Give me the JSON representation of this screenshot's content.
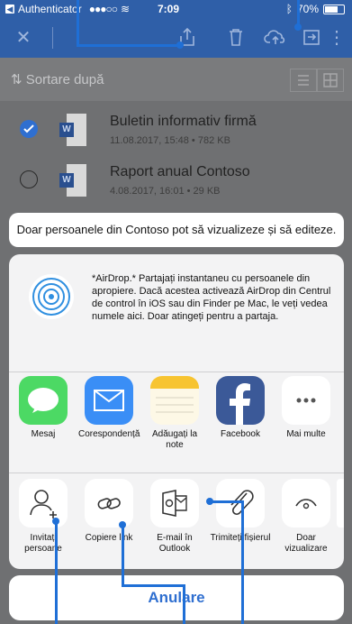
{
  "status_bar": {
    "app_name": "Authenticator",
    "signal": "●●●○○",
    "time": "7:09",
    "battery_pct": "70%"
  },
  "toolbar": {
    "icons": [
      "close-icon",
      "share-icon",
      "trash-icon",
      "cloud-upload-icon",
      "open-in-icon",
      "more-icon"
    ]
  },
  "sort": {
    "label": "⇅ Sortare după"
  },
  "files": [
    {
      "name": "Buletin informativ firmă",
      "meta": "11.08.2017, 15:48 • 782 KB",
      "selected": true
    },
    {
      "name": "Raport anual Contoso",
      "meta": "4.08.2017, 16:01 • 29 KB",
      "selected": false
    }
  ],
  "sheet": {
    "banner": "Doar persoanele din Contoso pot să vizualizeze și să editeze.",
    "airdrop_text": "*AirDrop.* Partajați instantaneu cu persoanele din apropiere. Dacă acestea activează AirDrop din Centrul de control în iOS sau din Finder pe Mac, le veți vedea numele aici. Doar atingeți pentru a partaja.",
    "apps": [
      {
        "label": "Mesaj",
        "icon": "messages-icon"
      },
      {
        "label": "Corespondență",
        "icon": "mail-icon"
      },
      {
        "label": "Adăugați la note",
        "icon": "notes-icon"
      },
      {
        "label": "Facebook",
        "icon": "facebook-icon"
      },
      {
        "label": "Mai multe",
        "icon": "more-icon"
      }
    ],
    "actions": [
      {
        "label": "Invitați persoane",
        "icon": "add-person-icon"
      },
      {
        "label": "Copiere link",
        "icon": "link-icon"
      },
      {
        "label": "E-mail în Outlook",
        "icon": "outlook-icon"
      },
      {
        "label": "Trimiteți fișierul",
        "icon": "paperclip-icon"
      },
      {
        "label": "Doar vizualizare",
        "icon": "eye-icon"
      }
    ],
    "cancel": "Anulare"
  },
  "colors": {
    "brand_blue": "#2f5fa8",
    "callout_blue": "#1f6fd6",
    "cancel_blue": "#2f6fd0"
  }
}
